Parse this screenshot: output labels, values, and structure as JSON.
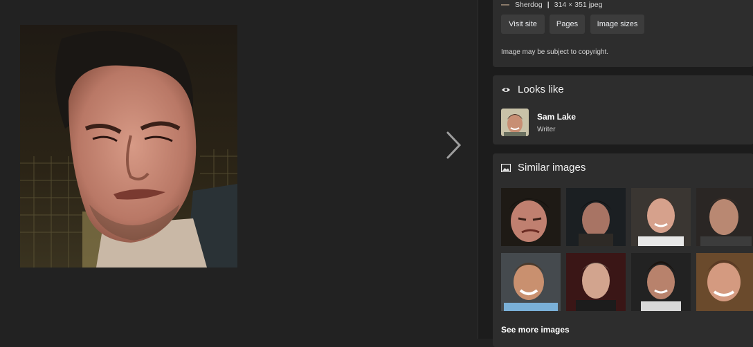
{
  "source": {
    "site": "Sherdog",
    "separator": "|",
    "info": "314 × 351 jpeg"
  },
  "buttons": {
    "visit": "Visit site",
    "pages": "Pages",
    "sizes": "Image sizes"
  },
  "copyright": "Image may be subject to copyright.",
  "looks_like": {
    "title": "Looks like",
    "icon": "eye-icon",
    "person": {
      "name": "Sam Lake",
      "role": "Writer"
    }
  },
  "similar": {
    "title": "Similar images",
    "icon": "image-icon",
    "see_more": "See more images"
  },
  "colors": {
    "background": "#222222",
    "panel": "#1c1c1c",
    "card": "#2d2d2d",
    "button": "#3c3c3c"
  }
}
